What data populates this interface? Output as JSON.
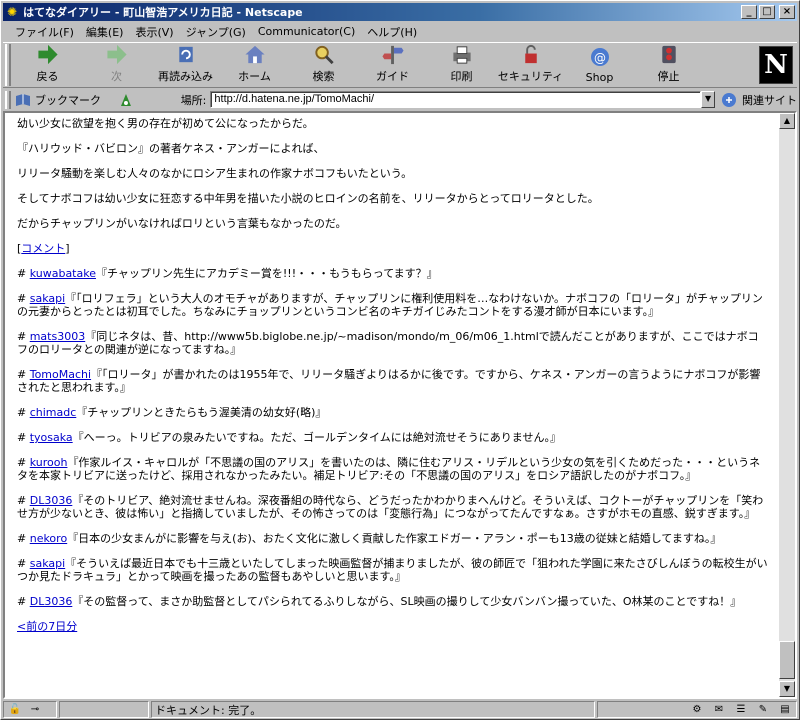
{
  "window": {
    "title": "はてなダイアリー - 町山智浩アメリカ日記 - Netscape"
  },
  "menu": {
    "items": [
      "ファイル(F)",
      "編集(E)",
      "表示(V)",
      "ジャンプ(G)",
      "Communicator(C)",
      "ヘルプ(H)"
    ]
  },
  "toolbar": {
    "buttons": [
      {
        "label": "戻る",
        "icon": "back-arrow-icon"
      },
      {
        "label": "次",
        "icon": "forward-arrow-icon"
      },
      {
        "label": "再読み込み",
        "icon": "reload-icon"
      },
      {
        "label": "ホーム",
        "icon": "home-icon"
      },
      {
        "label": "検索",
        "icon": "search-icon"
      },
      {
        "label": "ガイド",
        "icon": "guide-icon"
      },
      {
        "label": "印刷",
        "icon": "print-icon"
      },
      {
        "label": "セキュリティ",
        "icon": "security-lock-icon"
      },
      {
        "label": "Shop",
        "icon": "shop-icon"
      },
      {
        "label": "停止",
        "icon": "stop-icon"
      }
    ]
  },
  "location": {
    "bookmarks_label": "ブックマーク",
    "label": "場所:",
    "url": "http://d.hatena.ne.jp/TomoMachi/",
    "related_label": "関連サイト"
  },
  "content": {
    "paragraphs": [
      "幼い少女に欲望を抱く男の存在が初めて公になったからだ。",
      "『ハリウッド・バビロン』の著者ケネス・アンガーによれば、",
      "リリータ騒動を楽しむ人々のなかにロシア生まれの作家ナボコフもいたという。",
      "そしてナボコフは幼い少女に狂恋する中年男を描いた小説のヒロインの名前を、リリータからとってロリータとした。",
      "だからチャップリンがいなければロリという言葉もなかったのだ。"
    ],
    "comment_link": "コメント",
    "comment_brackets": [
      "[",
      "]"
    ],
    "comments": [
      {
        "user": "kuwabatake",
        "text": "『チャップリン先生にアカデミー賞を!!!・・・もうもらってます？』"
      },
      {
        "user": "sakapi",
        "text": "『「ロリフェラ」という大人のオモチャがありますが、チャップリンに権利使用料を…なわけないか。ナボコフの「ロリータ」がチャップリンの元妻からとったとは初耳でした。ちなみにチョップリンというコンビ名のキチガイじみたコントをする漫才師が日本にいます。』"
      },
      {
        "user": "mats3003",
        "text": "『同じネタは、昔、http://www5b.biglobe.ne.jp/~madison/mondo/m_06/m06_1.htmlで読んだことがありますが、ここではナボコフのロリータとの関連が逆になってますね。』"
      },
      {
        "user": "TomoMachi",
        "text": "『「ロリータ」が書かれたのは1955年で、リリータ騒ぎよりはるかに後です。ですから、ケネス・アンガーの言うようにナボコフが影響されたと思われます。』"
      },
      {
        "user": "chimadc",
        "text": "『チャップリンときたらもう渥美清の幼女好(略)』"
      },
      {
        "user": "tyosaka",
        "text": "『へーっ。トリビアの泉みたいですね。ただ、ゴールデンタイムには絶対流せそうにありません。』"
      },
      {
        "user": "kurooh",
        "text": "『作家ルイス・キャロルが「不思議の国のアリス」を書いたのは、隣に住むアリス・リデルという少女の気を引くためだった・・・というネタを本家トリビアに送ったけど、採用されなかったみたい。補足トリビア:その「不思議の国のアリス」をロシア語訳したのがナボコフ。』"
      },
      {
        "user": "DL3036",
        "text": "『そのトリビア、絶対流せませんね。深夜番組の時代なら、どうだったかわかりまへんけど。そういえば、コクトーがチャップリンを「笑わせ方が少ないとき、彼は怖い」と指摘していましたが、その怖さってのは「変態行為」につながってたんですなぁ。さすがホモの直感、鋭すぎます。』"
      },
      {
        "user": "nekoro",
        "text": "『日本の少女まんがに影響を与え(お)、おたく文化に激しく貢献した作家エドガー・アラン・ポーも13歳の従妹と結婚してますね。』"
      },
      {
        "user": "sakapi",
        "text": "『そういえば最近日本でも十三歳といたしてしまった映画監督が捕まりましたが、彼の師匠で「狙われた学園に来たさびしんぼうの転校生がいつか見たドラキュラ」とかって映画を撮ったあの監督もあやしいと思います。』"
      },
      {
        "user": "DL3036",
        "text": "『その監督って、まさか助監督としてパシられてるふりしながら、SL映画の撮りして少女バンバン撮っていた、O林某のことですね！』"
      }
    ],
    "prev_link": "<前の7日分"
  },
  "status": {
    "text": "ドキュメント: 完了。"
  },
  "colors": {
    "title_start": "#0a246a",
    "title_end": "#a6caf0",
    "link": "#0000cc"
  }
}
